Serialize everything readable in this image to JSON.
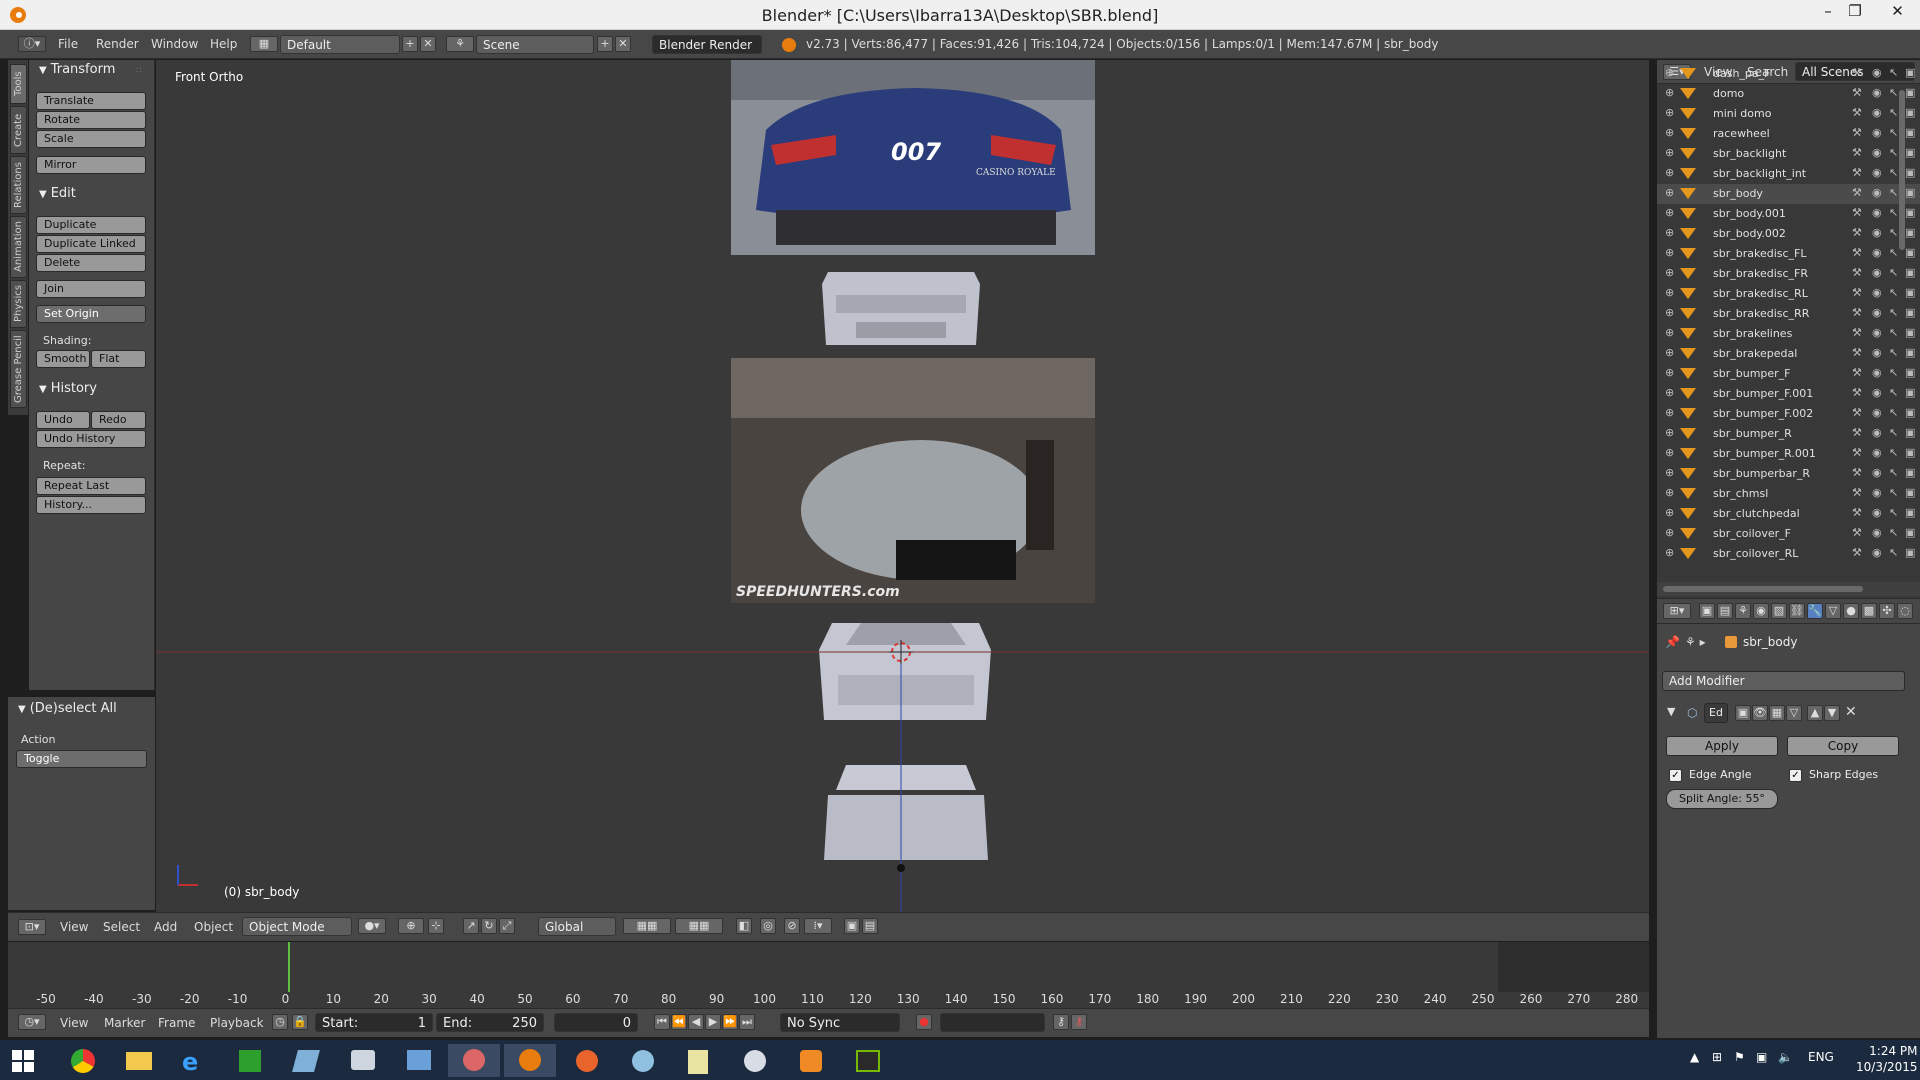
{
  "window": {
    "title": "Blender* [C:\\Users\\Ibarra13A\\Desktop\\SBR.blend]",
    "min": "–",
    "max": "❐",
    "close": "✕"
  },
  "info_header": {
    "menus": [
      "File",
      "Render",
      "Window",
      "Help"
    ],
    "layout": "Default",
    "scene": "Scene",
    "engine": "Blender Render",
    "stats": "v2.73 | Verts:86,477 | Faces:91,426 | Tris:104,724 | Objects:0/156 | Lamps:0/1 | Mem:147.67M | sbr_body"
  },
  "tool_tabs": [
    "Tools",
    "Create",
    "Relations",
    "Animation",
    "Physics",
    "Grease Pencil"
  ],
  "tool_shelf": {
    "transform": {
      "title": "Transform",
      "buttons": [
        "Translate",
        "Rotate",
        "Scale",
        "Mirror"
      ]
    },
    "edit": {
      "title": "Edit",
      "buttons": [
        "Duplicate",
        "Duplicate Linked",
        "Delete",
        "Join",
        "Set Origin"
      ],
      "shading_label": "Shading:",
      "smooth": "Smooth",
      "flat": "Flat"
    },
    "history": {
      "title": "History",
      "undo": "Undo",
      "redo": "Redo",
      "undo_history": "Undo History",
      "repeat_label": "Repeat:",
      "repeat_last": "Repeat Last",
      "history_btn": "History..."
    }
  },
  "operator_panel": {
    "title": "(De)select All",
    "action_label": "Action",
    "action_value": "Toggle"
  },
  "viewport": {
    "label": "Front Ortho",
    "object_label": "(0) sbr_body",
    "ref_text_007": "007",
    "ref_text_casino": "CASINO ROYALE",
    "ref_text_speedhunters": "SPEEDHUNTERS.com"
  },
  "view3d_header": {
    "menus": [
      "View",
      "Select",
      "Add",
      "Object"
    ],
    "mode": "Object Mode",
    "orientation": "Global"
  },
  "timeline": {
    "ruler": [
      "-50",
      "-40",
      "-30",
      "-20",
      "-10",
      "0",
      "10",
      "20",
      "30",
      "40",
      "50",
      "60",
      "70",
      "80",
      "90",
      "100",
      "110",
      "120",
      "130",
      "140",
      "150",
      "160",
      "170",
      "180",
      "190",
      "200",
      "210",
      "220",
      "230",
      "240",
      "250",
      "260",
      "270",
      "280"
    ],
    "current_frame_marker": 0,
    "menus": [
      "View",
      "Marker",
      "Frame",
      "Playback"
    ],
    "start_label": "Start:",
    "start": "1",
    "end_label": "End:",
    "end": "250",
    "current": "0",
    "sync": "No Sync"
  },
  "outliner": {
    "view": "View",
    "search": "Search",
    "scenes": "All Scenes",
    "items": [
      "dash_pa_F",
      "domo",
      "mini domo",
      "racewheel",
      "sbr_backlight",
      "sbr_backlight_int",
      "sbr_body",
      "sbr_body.001",
      "sbr_body.002",
      "sbr_brakedisc_FL",
      "sbr_brakedisc_FR",
      "sbr_brakedisc_RL",
      "sbr_brakedisc_RR",
      "sbr_brakelines",
      "sbr_brakepedal",
      "sbr_bumper_F",
      "sbr_bumper_F.001",
      "sbr_bumper_F.002",
      "sbr_bumper_R",
      "sbr_bumper_R.001",
      "sbr_bumperbar_R",
      "sbr_chmsl",
      "sbr_clutchpedal",
      "sbr_coilover_F",
      "sbr_coilover_RL"
    ],
    "selected": "sbr_body"
  },
  "properties": {
    "object": "sbr_body",
    "add_modifier": "Add Modifier",
    "mod_name": "Ed",
    "apply": "Apply",
    "copy": "Copy",
    "edge_angle": "Edge Angle",
    "sharp_edges": "Sharp Edges",
    "split_angle": "Split Angle:  55°"
  },
  "taskbar": {
    "lang": "ENG",
    "time": "1:24 PM",
    "date": "10/3/2015"
  },
  "colors": {
    "blender_orange": "#e87d0d",
    "taskbar": "#1b2a3e",
    "viewport": "#393939",
    "frame_marker": "#60c040"
  }
}
